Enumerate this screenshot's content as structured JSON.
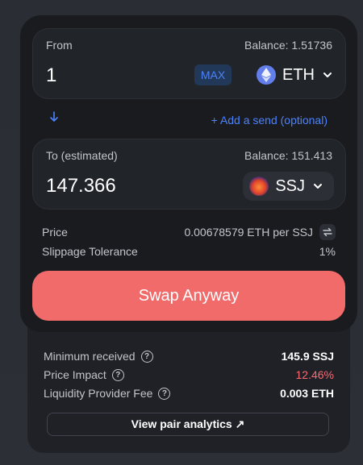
{
  "from": {
    "label": "From",
    "balance": "Balance: 1.51736",
    "amount": "1",
    "max_label": "MAX",
    "token": "ETH"
  },
  "add_send_label": "+ Add a send (optional)",
  "to": {
    "label": "To (estimated)",
    "balance": "Balance: 151.413",
    "amount": "147.366",
    "token": "SSJ"
  },
  "price": {
    "label": "Price",
    "value": "0.00678579 ETH per SSJ"
  },
  "slippage": {
    "label": "Slippage Tolerance",
    "value": "1%"
  },
  "swap_button_label": "Swap Anyway",
  "details": {
    "minimum_received": {
      "label": "Minimum received",
      "value": "145.9 SSJ"
    },
    "price_impact": {
      "label": "Price Impact",
      "value": "12.46%"
    },
    "lp_fee": {
      "label": "Liquidity Provider Fee",
      "value": "0.003 ETH"
    },
    "analytics_label": "View pair analytics ↗"
  },
  "colors": {
    "accent": "#4c82fb",
    "swap_button": "#f16b6b",
    "price_impact": "#ff6871"
  }
}
